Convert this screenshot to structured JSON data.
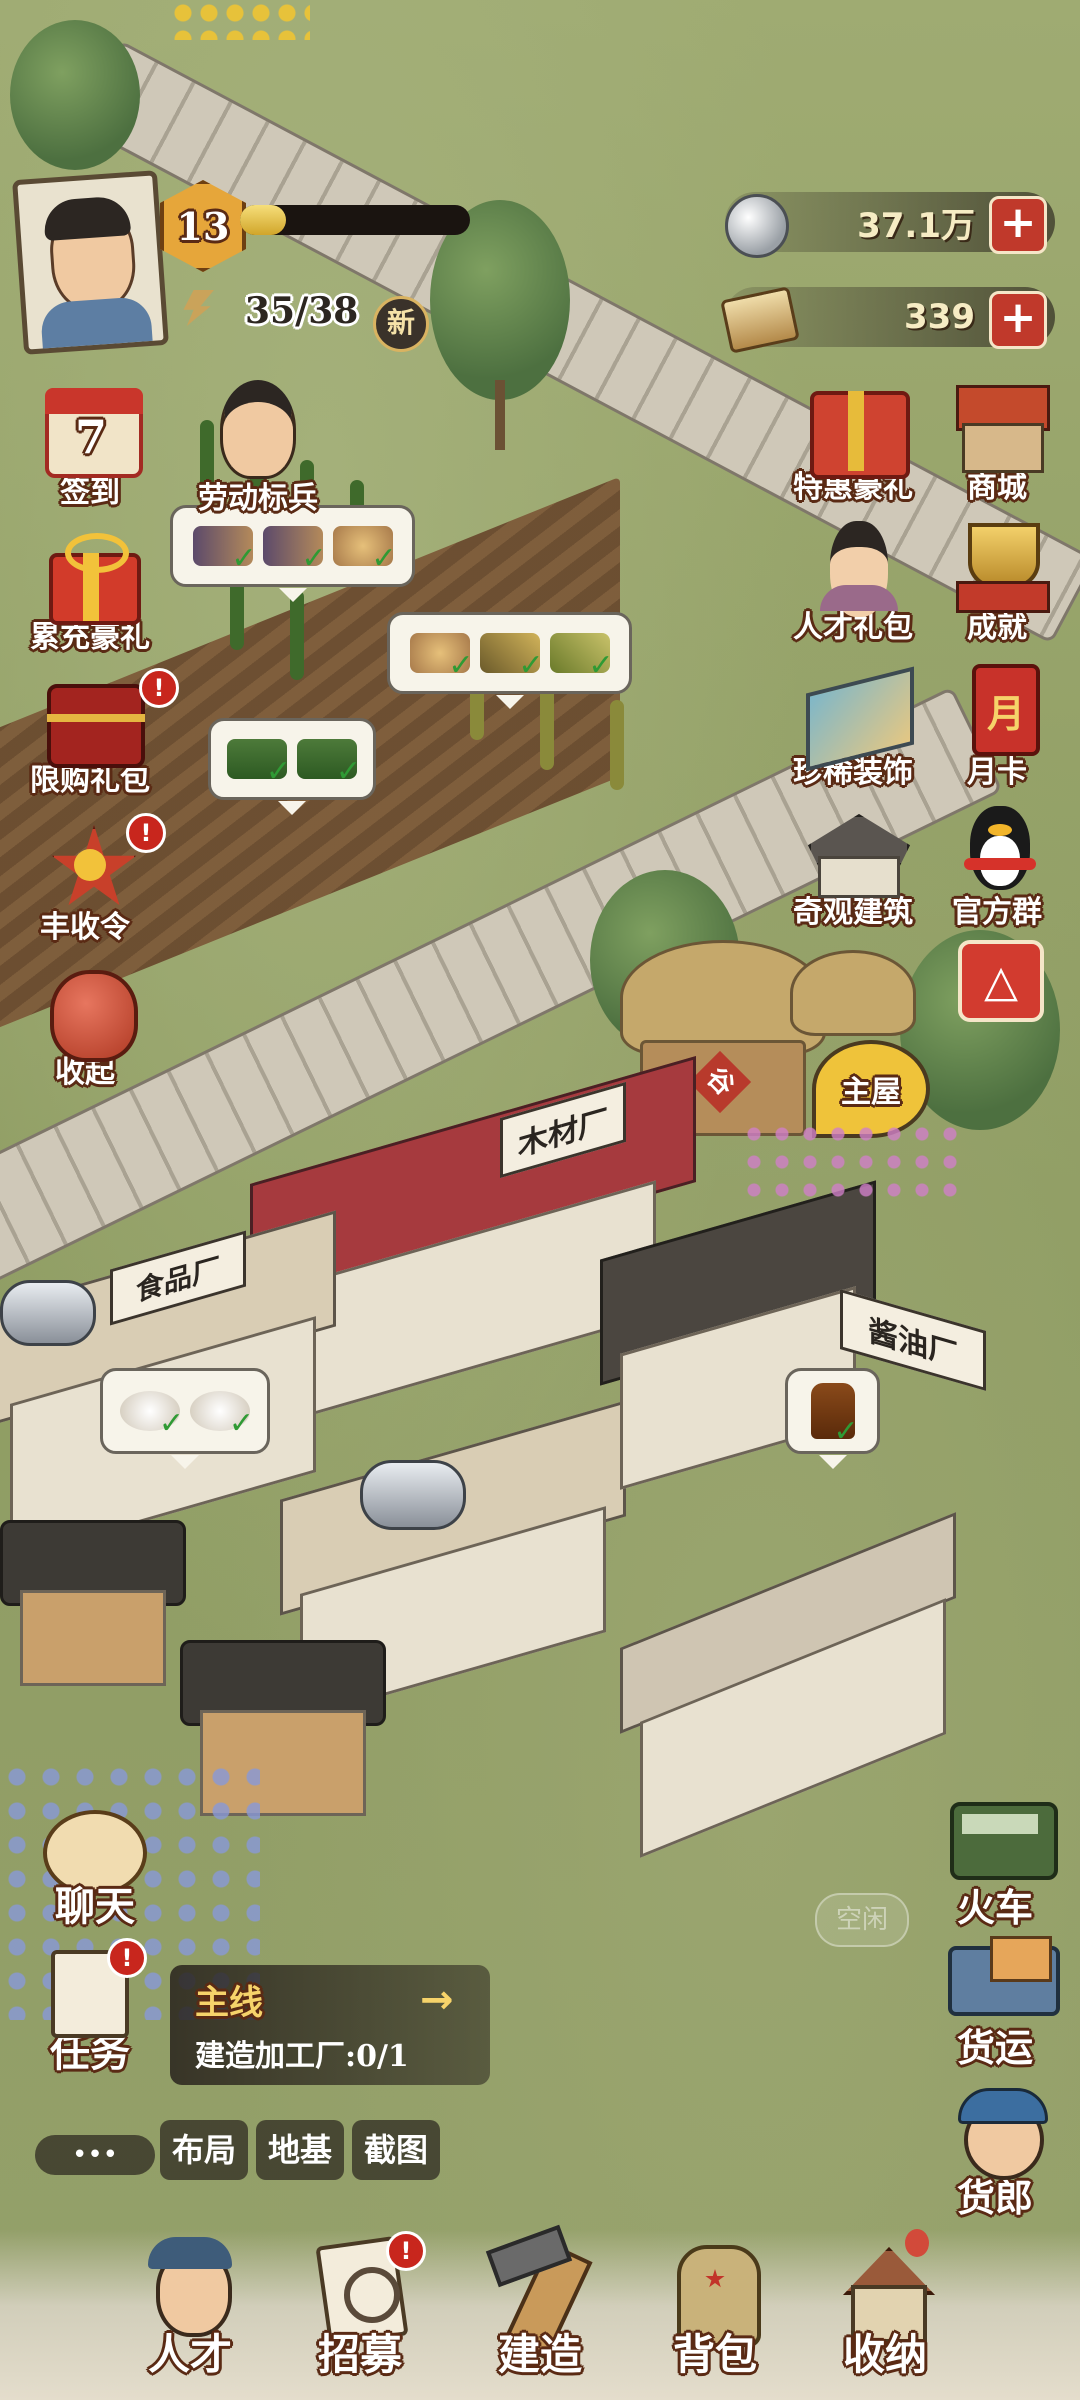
{
  "player": {
    "level": "13",
    "stamina": "35/38",
    "new_badge": "新"
  },
  "resources": {
    "coins": "37.1万",
    "cash": "339",
    "plus": "+"
  },
  "left_menu": [
    {
      "label": "签到",
      "day": "7"
    },
    {
      "label": "累充豪礼"
    },
    {
      "label": "限购礼包",
      "badge": "!"
    },
    {
      "label": "丰收令",
      "badge": "!"
    },
    {
      "label": "收起"
    }
  ],
  "worker_label": "劳动标兵",
  "right_menu_inner": [
    {
      "label": "特惠豪礼"
    },
    {
      "label": "人才礼包"
    },
    {
      "label": "珍稀装饰"
    },
    {
      "label": "奇观建筑"
    }
  ],
  "right_menu_outer": [
    {
      "label": "商城"
    },
    {
      "label": "成就"
    },
    {
      "label": "月卡",
      "glyph": "月"
    },
    {
      "label": "官方群"
    },
    {
      "label": "",
      "glyph": "△"
    }
  ],
  "map": {
    "granary_sign": "谷",
    "main_house": "主屋",
    "wood_factory_sign": "木材厂",
    "food_factory_sign": "食品厂",
    "sauce_factory_sign": "酱油厂",
    "idle_tag": "空闲"
  },
  "quest": {
    "type": "主线",
    "desc": "建造加工厂:0/1"
  },
  "chat_label": "聊天",
  "task_label": "任务",
  "tools": [
    "布局",
    "地基",
    "截图"
  ],
  "more": "•••",
  "right_bottom": [
    {
      "label": "火车"
    },
    {
      "label": "货运"
    },
    {
      "label": "货郎"
    }
  ],
  "bottom_nav": [
    {
      "label": "人才"
    },
    {
      "label": "招募",
      "badge": "!"
    },
    {
      "label": "建造"
    },
    {
      "label": "背包"
    },
    {
      "label": "收纳"
    }
  ]
}
